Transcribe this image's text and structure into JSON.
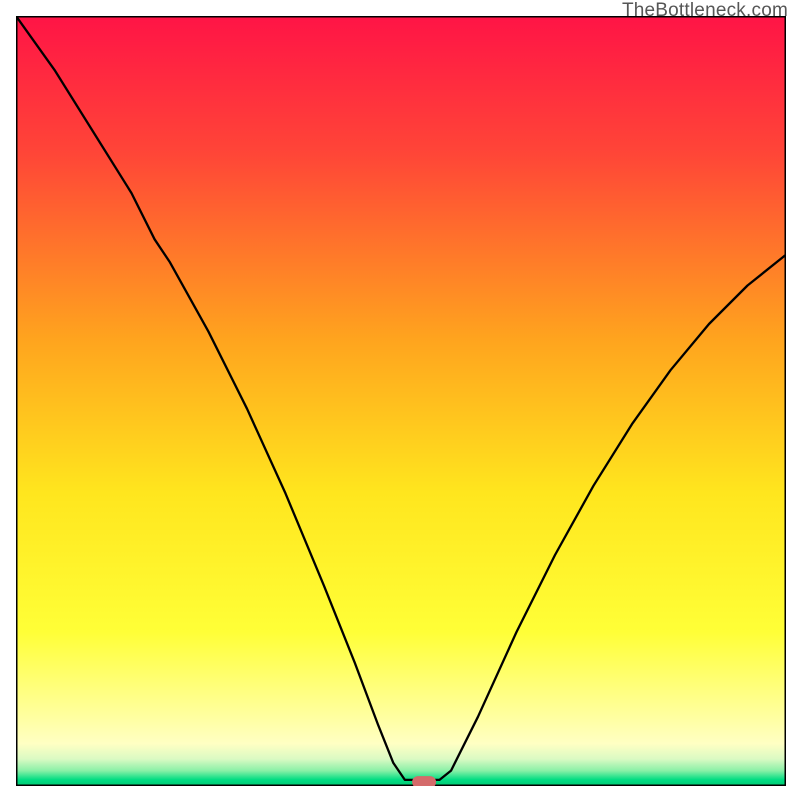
{
  "watermark": "TheBottleneck.com",
  "chart_data": {
    "type": "line",
    "title": "",
    "xlabel": "",
    "ylabel": "",
    "xlim": [
      0,
      100
    ],
    "ylim": [
      0,
      100
    ],
    "gradient_stops": [
      {
        "offset": 0,
        "color": "#ff1446"
      },
      {
        "offset": 0.18,
        "color": "#ff4637"
      },
      {
        "offset": 0.42,
        "color": "#ffa41e"
      },
      {
        "offset": 0.62,
        "color": "#ffe61e"
      },
      {
        "offset": 0.8,
        "color": "#ffff37"
      },
      {
        "offset": 0.905,
        "color": "#ffff9b"
      },
      {
        "offset": 0.945,
        "color": "#ffffc3"
      },
      {
        "offset": 0.965,
        "color": "#dafac3"
      },
      {
        "offset": 0.98,
        "color": "#8af0a7"
      },
      {
        "offset": 0.992,
        "color": "#00dc82"
      },
      {
        "offset": 1.0,
        "color": "#00c871"
      }
    ],
    "curve": [
      {
        "x": 0,
        "y": 100
      },
      {
        "x": 5,
        "y": 93
      },
      {
        "x": 10,
        "y": 85
      },
      {
        "x": 15,
        "y": 77
      },
      {
        "x": 18,
        "y": 71
      },
      {
        "x": 20,
        "y": 68
      },
      {
        "x": 25,
        "y": 59
      },
      {
        "x": 30,
        "y": 49
      },
      {
        "x": 35,
        "y": 38
      },
      {
        "x": 40,
        "y": 26
      },
      {
        "x": 44,
        "y": 16
      },
      {
        "x": 47,
        "y": 8
      },
      {
        "x": 49,
        "y": 3
      },
      {
        "x": 50.5,
        "y": 0.8
      },
      {
        "x": 55,
        "y": 0.8
      },
      {
        "x": 56.5,
        "y": 2
      },
      {
        "x": 60,
        "y": 9
      },
      {
        "x": 65,
        "y": 20
      },
      {
        "x": 70,
        "y": 30
      },
      {
        "x": 75,
        "y": 39
      },
      {
        "x": 80,
        "y": 47
      },
      {
        "x": 85,
        "y": 54
      },
      {
        "x": 90,
        "y": 60
      },
      {
        "x": 95,
        "y": 65
      },
      {
        "x": 100,
        "y": 69
      }
    ],
    "marker": {
      "x": 53,
      "y": 0.5,
      "color": "#d46a6a"
    }
  }
}
